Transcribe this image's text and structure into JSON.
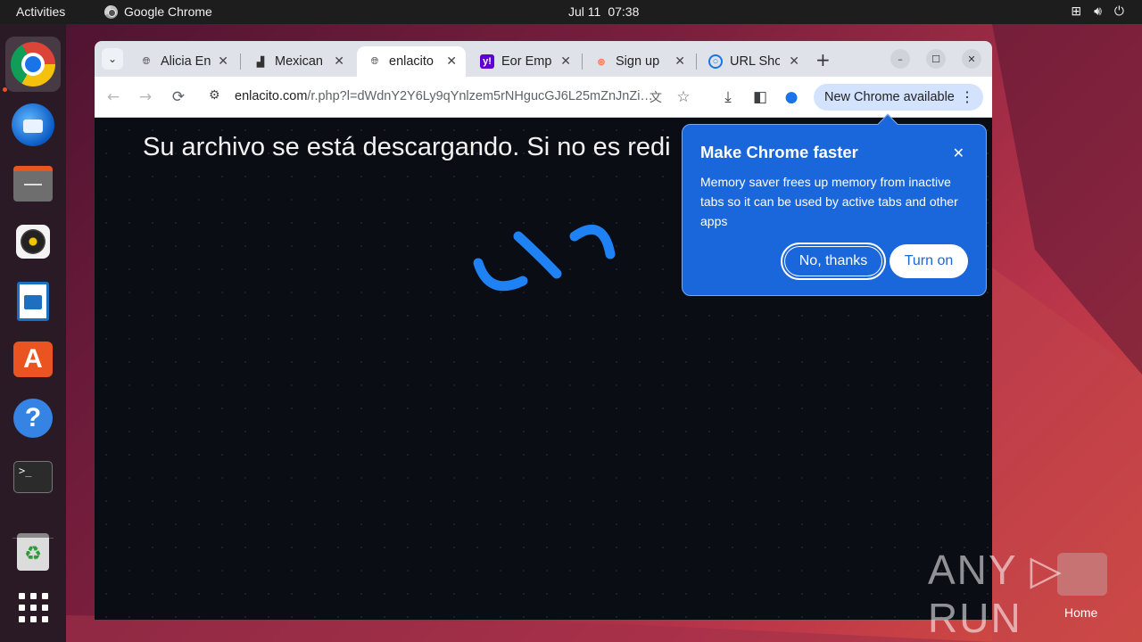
{
  "topbar": {
    "activities": "Activities",
    "app_name": "Google Chrome",
    "date": "Jul 11",
    "time": "07:38",
    "tray_icons": [
      "network-icon",
      "volume-icon",
      "power-icon"
    ]
  },
  "dock": {
    "items": [
      "chrome",
      "thunderbird",
      "files",
      "rhythmbox",
      "libreoffice-writer",
      "app-center",
      "help",
      "terminal",
      "trash",
      "show-apps"
    ],
    "terminal_prompt": ">_",
    "store_glyph": "A",
    "help_glyph": "?",
    "trash_glyph": "♻"
  },
  "browser": {
    "tabs": [
      {
        "title": "Alicia En",
        "favicon": "globe-icon"
      },
      {
        "title": "Mexican",
        "favicon": "chart-icon"
      },
      {
        "title": "enlacito",
        "favicon": "globe-icon",
        "active": true
      },
      {
        "title": "Eor Emp",
        "favicon": "yahoo-icon"
      },
      {
        "title": "Sign up",
        "favicon": "hubspot-icon"
      },
      {
        "title": "URL Sho",
        "favicon": "shortener-icon"
      }
    ],
    "url_host": "enlacito.com",
    "url_path": "/r.php?l=dWdnY2Y6Ly9qYnlzem5rNHgucGJ6L25mZnJnZi…",
    "new_chrome_label": "New Chrome available",
    "page_text": "Su archivo se está descargando. Si no es redi"
  },
  "popup": {
    "title": "Make Chrome faster",
    "body": "Memory saver frees up memory from inactive tabs so it can be used by active tabs and other apps",
    "decline": "No, thanks",
    "accept": "Turn on",
    "color": "#1a66db"
  },
  "desktop": {
    "watermark": "ANY ▷ RUN",
    "home_label": "Home"
  }
}
